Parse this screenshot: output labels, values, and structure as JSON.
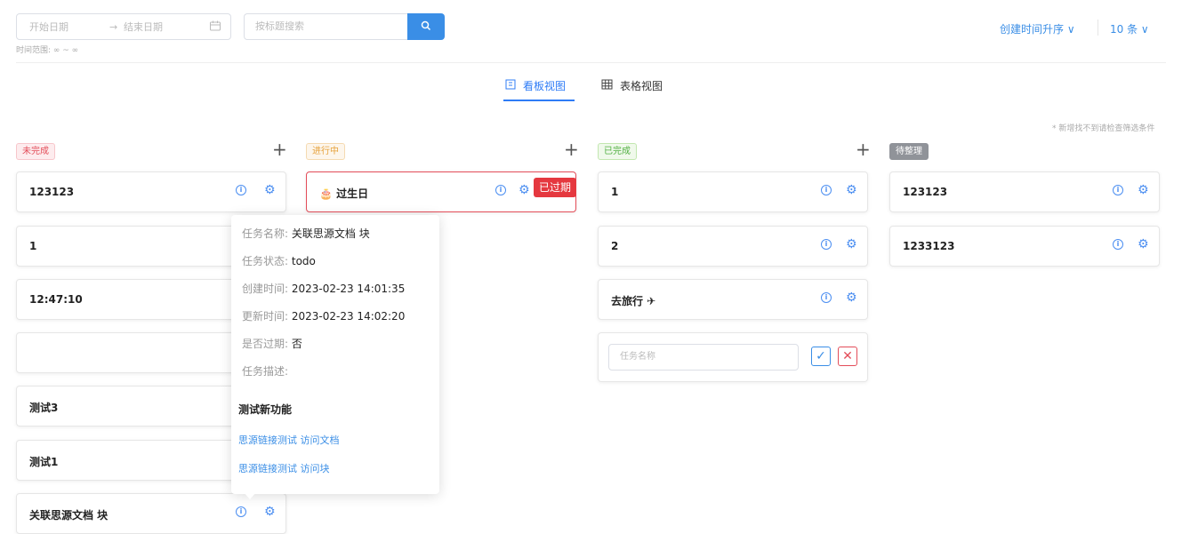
{
  "toolbar": {
    "start_date_placeholder": "开始日期",
    "end_date_placeholder": "结束日期",
    "range_arrow": "→",
    "range_label": "时间范围: ∞ ~ ∞",
    "search_placeholder": "按标题搜索",
    "sort_label": "创建时间升序 ∨",
    "page_size_label": "10 条 ∨"
  },
  "tabs": [
    {
      "label": "看板视图",
      "active": true
    },
    {
      "label": "表格视图",
      "active": false
    }
  ],
  "hint": "* 新增找不到请检查筛选条件",
  "columns": [
    {
      "tag": "未完成",
      "cards": [
        "123123",
        "1",
        "12:47:10",
        "",
        "测试3",
        "测试1",
        "关联思源文档 块"
      ]
    },
    {
      "tag": "进行中",
      "cards": [
        "🎂 过生日"
      ],
      "overdue_badge": "已过期"
    },
    {
      "tag": "已完成",
      "cards": [
        "1",
        "2",
        "去旅行 ✈"
      ],
      "new_task_placeholder": "任务名称"
    },
    {
      "tag": "待整理",
      "cards": [
        "123123",
        "1233123"
      ]
    }
  ],
  "popover": {
    "rows": [
      {
        "key": "任务名称:",
        "value": "关联思源文档 块"
      },
      {
        "key": "任务状态:",
        "value": "todo"
      },
      {
        "key": "创建时间:",
        "value": "2023-02-23 14:01:35"
      },
      {
        "key": "更新时间:",
        "value": "2023-02-23 14:02:20"
      },
      {
        "key": "是否过期:",
        "value": "否"
      },
      {
        "key": "任务描述:",
        "value": ""
      }
    ],
    "section_title": "测试新功能",
    "links": [
      "思源链接测试 访问文档",
      "思源链接测试 访问块"
    ]
  },
  "colors": {
    "accent": "#3a8ee6",
    "danger": "#e34d59"
  }
}
